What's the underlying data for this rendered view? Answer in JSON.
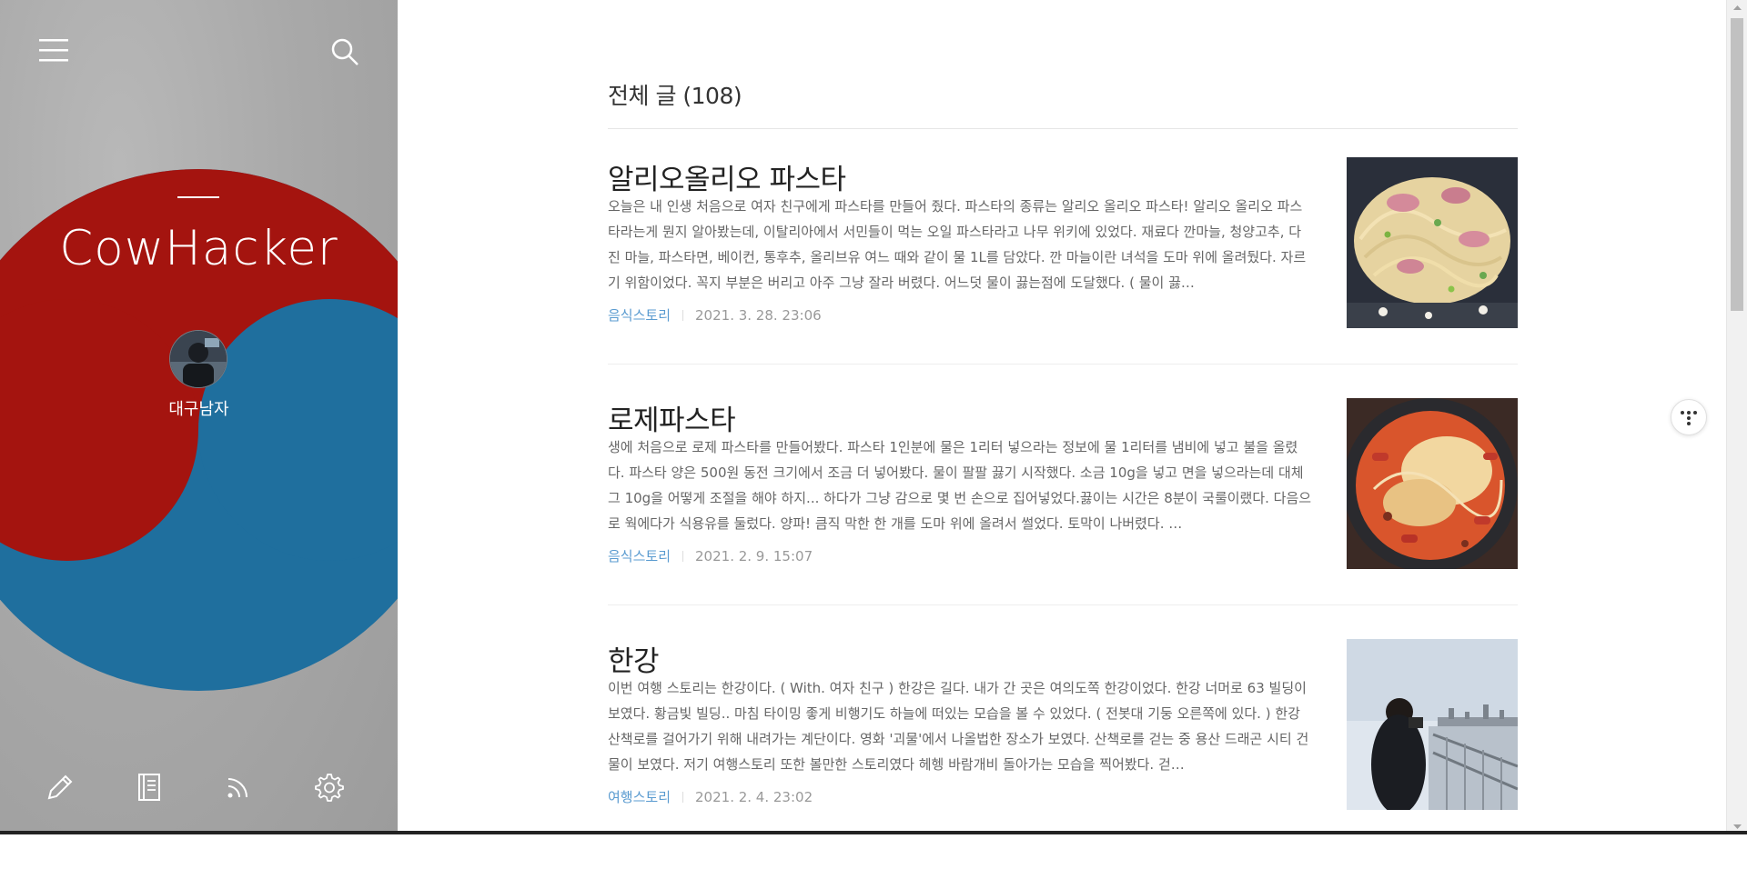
{
  "blog": {
    "title": "CowHacker",
    "owner_name": "대구남자"
  },
  "colors": {
    "red": "#a4140f",
    "blue": "#1f6f9e",
    "accent_link": "#5a9bd0"
  },
  "sidebar": {
    "top_icons": [
      "menu-icon",
      "search-icon"
    ],
    "bottom_icons": [
      "pencil-icon",
      "notebook-icon",
      "rss-icon",
      "gear-icon"
    ]
  },
  "main": {
    "category_heading": "전체 글 (108)",
    "posts": [
      {
        "title": "알리오올리오 파스타",
        "summary": "오늘은 내 인생 처음으로 여자 친구에게 파스타를 만들어 줬다. 파스타의 종류는 알리오 올리오 파스타! 알리오 올리오 파스타라는게 뭔지 알아봤는데, 이탈리아에서 서민들이 먹는 오일 파스타라고 나무 위키에 있었다. 재료다 깐마늘, 청양고추, 다진 마늘, 파스타면, 베이컨, 통후추, 올리브유 여느 때와 같이 물 1L를 담았다. 깐 마늘이란 녀석을 도마 위에 올려뒀다. 자르기 위함이었다. 꼭지 부분은 버리고 아주 그냥 잘라 버렸다. 어느덧 물이 끓는점에 도달했다. ( 물이 끓…",
        "category": "음식스토리",
        "date": "2021. 3. 28. 23:06",
        "thumb": "pasta-aglio-olio-photo"
      },
      {
        "title": "로제파스타",
        "summary": "생에 처음으로 로제 파스타를 만들어봤다. 파스타 1인분에 물은 1리터 넣으라는 정보에 물 1리터를 냄비에 넣고 불을 올렸다. 파스타 양은 500원 동전 크기에서 조금 더 넣어봤다. 물이 팔팔 끓기 시작했다. 소금 10g을 넣고 면을 넣으라는데 대체 그 10g을 어떻게 조절을 해야 하지... 하다가 그냥 감으로 몇 번 손으로 집어넣었다.끓이는 시간은 8분이 국룰이랬다. 다음으로 웍에다가 식용유를 둘렀다. 양파! 큼직 막한 한 개를 도마 위에 올려서 썰었다. 토막이 나버렸다. …",
        "category": "음식스토리",
        "date": "2021. 2. 9. 15:07",
        "thumb": "rose-pasta-photo"
      },
      {
        "title": "한강",
        "summary": "이번 여행 스토리는 한강이다. ( With. 여자 친구 ) 한강은 길다. 내가 간 곳은 여의도쪽 한강이었다. 한강 너머로 63 빌딩이 보였다. 황금빛 빌딩.. 마침 타이밍 좋게 비행기도 하늘에 떠있는 모습을 볼 수 있었다. ( 전봇대 기둥 오른쪽에 있다. ) 한강 산책로를 걸어가기 위해 내려가는 계단이다. 영화 '괴물'에서 나올법한 장소가 보였다. 산책로를 걷는 중 용산 드래곤 시티 건물이 보였다. 저기 여행스토리 또한 볼만한 스토리였다 헤헹 바람개비 돌아가는 모습을 찍어봤다. 걷…",
        "category": "여행스토리",
        "date": "2021. 2. 4. 23:02",
        "thumb": "han-river-photo"
      }
    ]
  }
}
